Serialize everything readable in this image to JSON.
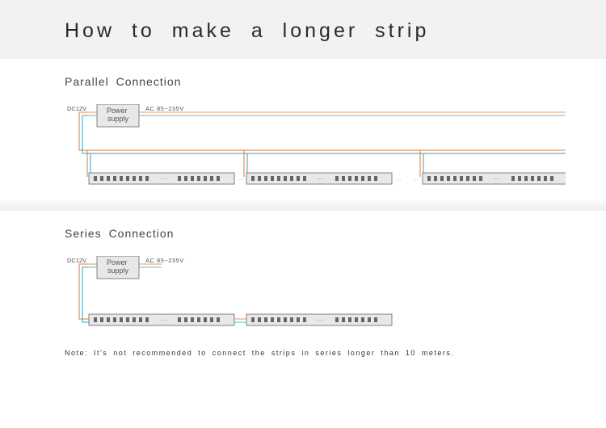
{
  "title": "How to make a longer strip",
  "parallel": {
    "heading": "Parallel Connection",
    "dc_label": "DC12V",
    "ac_label": "AC 85~235V",
    "power_label": "Power\nsupply"
  },
  "series": {
    "heading": "Series Connection",
    "dc_label": "DC12V",
    "ac_label": "AC 85~235V",
    "power_label": "Power\nsupply",
    "note": "Note: It's not recommended to connect the strips in series longer than 10 meters."
  }
}
